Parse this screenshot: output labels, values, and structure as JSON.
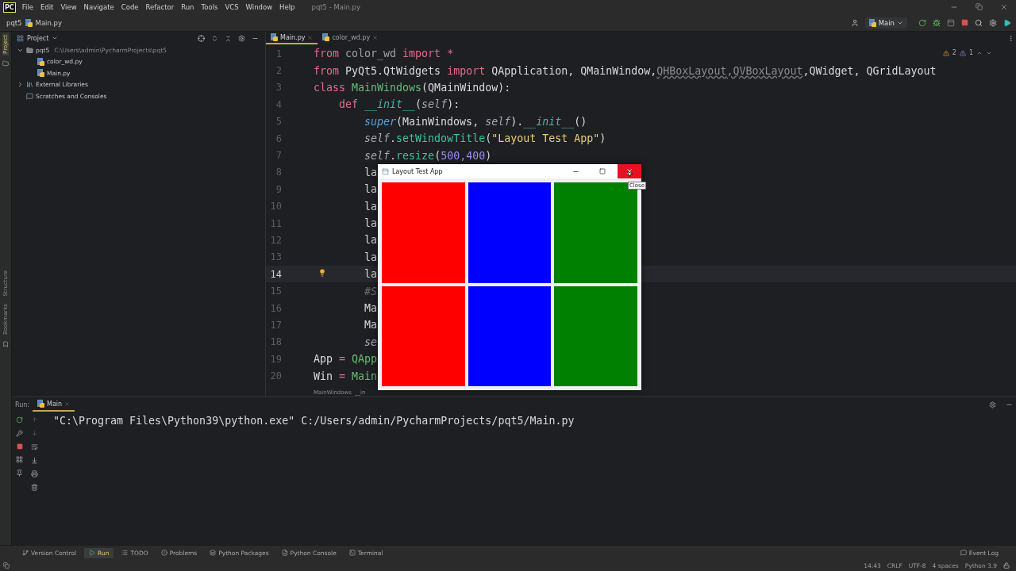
{
  "menubar": {
    "logo": "PC",
    "menus": [
      "File",
      "Edit",
      "View",
      "Navigate",
      "Code",
      "Refactor",
      "Run",
      "Tools",
      "VCS",
      "Window",
      "Help"
    ],
    "title": "pqt5 - Main.py"
  },
  "navbar": {
    "breadcrumbs": [
      "pqt5",
      "Main.py"
    ],
    "run_config": "Main"
  },
  "left_strip": {
    "top": [
      {
        "label": "Project",
        "selected": true
      }
    ],
    "bottom": [
      {
        "label": "Structure",
        "selected": false
      },
      {
        "label": "Bookmarks",
        "selected": false
      }
    ]
  },
  "project_panel": {
    "title": "Project",
    "tree": [
      {
        "name": "pqt5",
        "path": "C:\\Users\\admin\\PycharmProjects\\pqt5",
        "kind": "folder",
        "expanded": true,
        "children": [
          {
            "name": "color_wd.py",
            "kind": "python"
          },
          {
            "name": "Main.py",
            "kind": "python"
          }
        ]
      },
      {
        "name": "External Libraries",
        "kind": "library",
        "expanded": false
      },
      {
        "name": "Scratches and Consoles",
        "kind": "scratch"
      }
    ]
  },
  "editor": {
    "tabs": [
      {
        "label": "Main.py",
        "selected": true
      },
      {
        "label": "color_wd.py",
        "selected": false
      }
    ],
    "inspections": {
      "warnings": "2",
      "weak_warnings": "1"
    },
    "lines": [
      {
        "number": "1",
        "current": false,
        "tokens": [
          {
            "kind": "kw",
            "text": "from"
          },
          {
            "kind": "muted",
            "text": " color_wd "
          },
          {
            "kind": "kw",
            "text": "import *"
          }
        ]
      },
      {
        "number": "2",
        "current": false,
        "tokens": [
          {
            "kind": "kw",
            "text": "from"
          },
          {
            "kind": "plain",
            "text": " PyQt5.QtWidgets "
          },
          {
            "kind": "kw",
            "text": "import"
          },
          {
            "kind": "plain",
            "text": " QApplication, QMainWindow,"
          },
          {
            "kind": "unused",
            "text": "QHBoxLayout"
          },
          {
            "kind": "unused",
            "text": ",QVBoxLayout"
          },
          {
            "kind": "plain",
            "text": ",QWidget, QGridLayout"
          }
        ]
      },
      {
        "number": "3",
        "current": false,
        "tokens": [
          {
            "kind": "kw",
            "text": "class "
          },
          {
            "kind": "cls",
            "text": "MainWindows"
          },
          {
            "kind": "plain",
            "text": "(QMainWindow):"
          }
        ]
      },
      {
        "number": "4",
        "current": false,
        "tokens": [
          {
            "kind": "kw",
            "text": "    def "
          },
          {
            "kind": "magic",
            "text": "__init__"
          },
          {
            "kind": "plain",
            "text": "("
          },
          {
            "kind": "self",
            "text": "self"
          },
          {
            "kind": "plain",
            "text": "):"
          }
        ]
      },
      {
        "number": "5",
        "current": false,
        "tokens": [
          {
            "kind": "builtin",
            "text": "        super"
          },
          {
            "kind": "plain",
            "text": "(MainWindows, "
          },
          {
            "kind": "self",
            "text": "self"
          },
          {
            "kind": "plain",
            "text": ")."
          },
          {
            "kind": "magic",
            "text": "__init__"
          },
          {
            "kind": "plain",
            "text": "()"
          }
        ]
      },
      {
        "number": "6",
        "current": false,
        "tokens": [
          {
            "kind": "self",
            "text": "        self"
          },
          {
            "kind": "plain",
            "text": "."
          },
          {
            "kind": "method",
            "text": "setWindowTitle"
          },
          {
            "kind": "plain",
            "text": "("
          },
          {
            "kind": "string",
            "text": "\"Layout Test App\""
          },
          {
            "kind": "plain",
            "text": ")"
          }
        ]
      },
      {
        "number": "7",
        "current": false,
        "tokens": [
          {
            "kind": "self",
            "text": "        self"
          },
          {
            "kind": "plain",
            "text": "."
          },
          {
            "kind": "method",
            "text": "resize"
          },
          {
            "kind": "plain",
            "text": "("
          },
          {
            "kind": "number",
            "text": "500,400"
          },
          {
            "kind": "plain",
            "text": ")"
          }
        ]
      },
      {
        "number": "8",
        "current": false,
        "tokens": [
          {
            "kind": "plain",
            "text": "        la"
          }
        ]
      },
      {
        "number": "9",
        "current": false,
        "tokens": [
          {
            "kind": "plain",
            "text": "        la"
          }
        ]
      },
      {
        "number": "10",
        "current": false,
        "tokens": [
          {
            "kind": "plain",
            "text": "        la"
          }
        ]
      },
      {
        "number": "11",
        "current": false,
        "tokens": [
          {
            "kind": "plain",
            "text": "        la"
          }
        ]
      },
      {
        "number": "12",
        "current": false,
        "tokens": [
          {
            "kind": "plain",
            "text": "        la"
          }
        ]
      },
      {
        "number": "13",
        "current": false,
        "tokens": [
          {
            "kind": "plain",
            "text": "        la"
          }
        ]
      },
      {
        "number": "14",
        "current": true,
        "tokens": [
          {
            "kind": "plain",
            "text": "        la"
          }
        ]
      },
      {
        "number": "15",
        "current": false,
        "tokens": [
          {
            "kind": "comment",
            "text": "        #S"
          }
        ]
      },
      {
        "number": "16",
        "current": false,
        "tokens": [
          {
            "kind": "plain",
            "text": "        Ma"
          }
        ]
      },
      {
        "number": "17",
        "current": false,
        "tokens": [
          {
            "kind": "plain",
            "text": "        Ma"
          }
        ]
      },
      {
        "number": "18",
        "current": false,
        "tokens": [
          {
            "kind": "self",
            "text": "        se"
          }
        ]
      },
      {
        "number": "19",
        "current": false,
        "tokens": [
          {
            "kind": "plain",
            "text": "App "
          },
          {
            "kind": "kw",
            "text": "="
          },
          {
            "kind": "cls",
            "text": " QApp"
          }
        ]
      },
      {
        "number": "20",
        "current": false,
        "tokens": [
          {
            "kind": "plain",
            "text": "Win "
          },
          {
            "kind": "kw",
            "text": "="
          },
          {
            "kind": "cls",
            "text": " Main"
          }
        ]
      }
    ],
    "breadcrumbs": [
      "MainWindows",
      "__in"
    ]
  },
  "qt_window": {
    "title": "Layout Test App",
    "close_hovered": true,
    "tooltip": "Close",
    "cells": [
      {
        "color": "#ff0000"
      },
      {
        "color": "#0000ff"
      },
      {
        "color": "#008000"
      },
      {
        "color": "#ff0000"
      },
      {
        "color": "#0000ff"
      },
      {
        "color": "#008000"
      }
    ]
  },
  "run_panel": {
    "label": "Run:",
    "tabs": [
      {
        "label": "Main",
        "selected": true
      }
    ],
    "output": [
      "\"C:\\Program Files\\Python39\\python.exe\" C:/Users/admin/PycharmProjects/pqt5/Main.py"
    ]
  },
  "tool_windows": [
    {
      "label": "Version Control",
      "kind": "vcs",
      "selected": false
    },
    {
      "label": "Run",
      "kind": "run",
      "selected": true
    },
    {
      "label": "TODO",
      "kind": "todo",
      "selected": false
    },
    {
      "label": "Problems",
      "kind": "problems",
      "selected": false
    },
    {
      "label": "Python Packages",
      "kind": "packages",
      "selected": false
    },
    {
      "label": "Python Console",
      "kind": "console",
      "selected": false
    },
    {
      "label": "Terminal",
      "kind": "terminal",
      "selected": false
    }
  ],
  "event_log": "Event Log",
  "status_bar": [
    "14:43",
    "CRLF",
    "UTF-8",
    "4 spaces",
    "Python 3.9"
  ]
}
